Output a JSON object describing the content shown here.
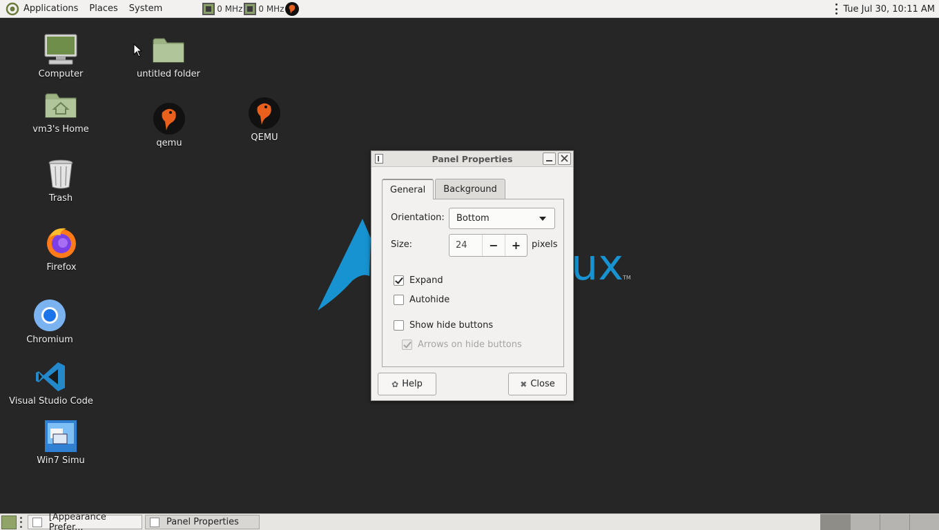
{
  "top_panel": {
    "menus": [
      "Applications",
      "Places",
      "System"
    ],
    "cpu1": "0 MHz",
    "cpu2": "0 MHz",
    "clock": "Tue Jul 30, 10:11 AM"
  },
  "desktop_icons": [
    {
      "label": "Computer",
      "icon": "computer-icon"
    },
    {
      "label": "untitled folder",
      "icon": "folder-icon"
    },
    {
      "label": "vm3's Home",
      "icon": "home-folder-icon"
    },
    {
      "label": "qemu",
      "icon": "qemu-icon"
    },
    {
      "label": "QEMU",
      "icon": "qemu-icon"
    },
    {
      "label": "Trash",
      "icon": "trash-icon"
    },
    {
      "label": "Firefox",
      "icon": "firefox-icon"
    },
    {
      "label": "Chromium",
      "icon": "chromium-icon"
    },
    {
      "label": "Visual Studio Code",
      "icon": "vscode-icon"
    },
    {
      "label": "Win7 Simu",
      "icon": "win7-icon"
    }
  ],
  "wallpaper_text": "ux",
  "dialog": {
    "title": "Panel Properties",
    "tabs": [
      "General",
      "Background"
    ],
    "active_tab": "General",
    "orientation_label": "Orientation:",
    "orientation_value": "Bottom",
    "size_label": "Size:",
    "size_value": "24",
    "size_unit": "pixels",
    "checkboxes": [
      {
        "label": "Expand",
        "checked": true,
        "enabled": true
      },
      {
        "label": "Autohide",
        "checked": false,
        "enabled": true
      },
      {
        "label": "Show hide buttons",
        "checked": false,
        "enabled": true
      },
      {
        "label": "Arrows on hide buttons",
        "checked": true,
        "enabled": false
      }
    ],
    "help_label": "Help",
    "close_label": "Close"
  },
  "taskbar": {
    "tasks": [
      "[Appearance Prefer...",
      "Panel Properties"
    ],
    "active_task": "Panel Properties",
    "workspace_count": 4
  },
  "colors": {
    "desktop_bg": "#262626",
    "arch_blue": "#1793d1",
    "panel_bg": "#f2f1f0"
  }
}
